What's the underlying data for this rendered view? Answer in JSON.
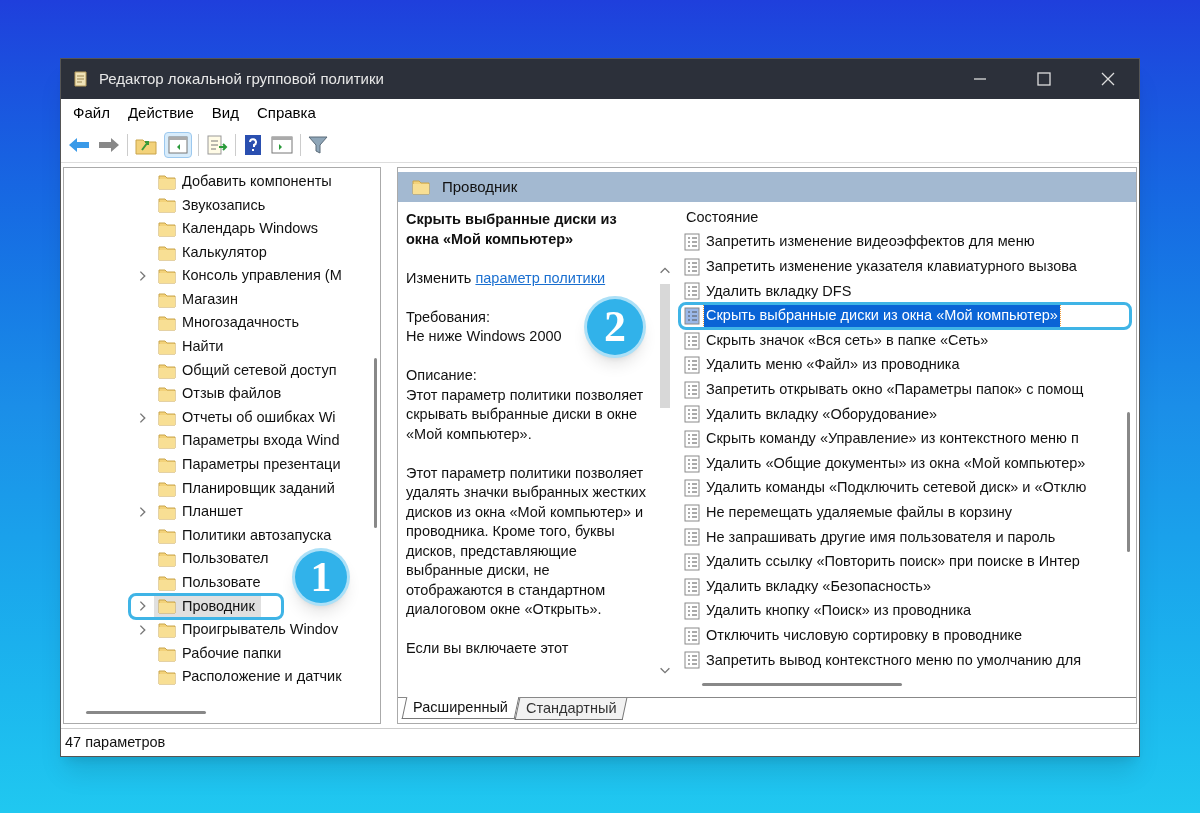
{
  "window": {
    "title": "Редактор локальной групповой политики"
  },
  "menu": [
    "Файл",
    "Действие",
    "Вид",
    "Справка"
  ],
  "tree": {
    "items": [
      {
        "label": "Добавить компоненты",
        "expandable": false,
        "selected": false
      },
      {
        "label": "Звукозапись",
        "expandable": false,
        "selected": false
      },
      {
        "label": "Календарь Windows",
        "expandable": false,
        "selected": false
      },
      {
        "label": "Калькулятор",
        "expandable": false,
        "selected": false
      },
      {
        "label": "Консоль управления (M",
        "expandable": true,
        "selected": false
      },
      {
        "label": "Магазин",
        "expandable": false,
        "selected": false
      },
      {
        "label": "Многозадачность",
        "expandable": false,
        "selected": false
      },
      {
        "label": "Найти",
        "expandable": false,
        "selected": false
      },
      {
        "label": "Общий сетевой доступ",
        "expandable": false,
        "selected": false
      },
      {
        "label": "Отзыв файлов",
        "expandable": false,
        "selected": false
      },
      {
        "label": "Отчеты об ошибках Wi",
        "expandable": true,
        "selected": false
      },
      {
        "label": "Параметры входа Wind",
        "expandable": false,
        "selected": false
      },
      {
        "label": "Параметры презентаци",
        "expandable": false,
        "selected": false
      },
      {
        "label": "Планировщик заданий",
        "expandable": false,
        "selected": false
      },
      {
        "label": "Планшет",
        "expandable": true,
        "selected": false
      },
      {
        "label": "Политики автозапуска",
        "expandable": false,
        "selected": false
      },
      {
        "label": "Пользовател",
        "expandable": false,
        "selected": false
      },
      {
        "label": "Пользовате",
        "expandable": false,
        "selected": false
      },
      {
        "label": "Проводник",
        "expandable": true,
        "selected": true
      },
      {
        "label": "Проигрыватель Windov",
        "expandable": true,
        "selected": false
      },
      {
        "label": "Рабочие папки",
        "expandable": false,
        "selected": false
      },
      {
        "label": "Расположение и датчик",
        "expandable": false,
        "selected": false
      }
    ]
  },
  "header": {
    "title": "Проводник"
  },
  "description": {
    "title": "Скрыть выбранные диски из окна «Мой компьютер»",
    "edit_prefix": "Изменить",
    "edit_link": "параметр политики",
    "paragraphs": [
      "Требования:\nНе ниже Windows 2000",
      "Описание:\nЭтот параметр политики позволяет скрывать выбранные диски в окне «Мой компьютер».",
      "Этот параметр политики позволяет удалять значки выбранных жестких дисков из окна «Мой компьютер» и проводника. Кроме того, буквы дисков, представляющие выбранные диски, не отображаются в стандартном диалоговом окне «Открыть».",
      "Если вы включаете этот"
    ]
  },
  "list": {
    "column": "Состояние",
    "rows": [
      {
        "label": "Запретить изменение видеоэффектов для меню",
        "selected": false
      },
      {
        "label": "Запретить изменение указателя клавиатурного вызова",
        "selected": false
      },
      {
        "label": "Удалить вкладку DFS",
        "selected": false
      },
      {
        "label": "Скрыть выбранные диски из окна «Мой компьютер»",
        "selected": true
      },
      {
        "label": "Скрыть значок «Вся сеть» в папке «Сеть»",
        "selected": false
      },
      {
        "label": "Удалить меню «Файл» из проводника",
        "selected": false
      },
      {
        "label": "Запретить открывать окно «Параметры папок» с помощ",
        "selected": false
      },
      {
        "label": "Удалить вкладку «Оборудование»",
        "selected": false
      },
      {
        "label": "Скрыть команду «Управление» из контекстного меню п",
        "selected": false
      },
      {
        "label": "Удалить «Общие документы» из окна «Мой компьютер»",
        "selected": false
      },
      {
        "label": "Удалить команды «Подключить сетевой диск» и «Отклю",
        "selected": false
      },
      {
        "label": "Не перемещать удаляемые файлы в корзину",
        "selected": false
      },
      {
        "label": "Не запрашивать другие имя пользователя и пароль",
        "selected": false
      },
      {
        "label": "Удалить ссылку «Повторить поиск» при поиске в Интер",
        "selected": false
      },
      {
        "label": "Удалить вкладку «Безопасность»",
        "selected": false
      },
      {
        "label": "Удалить кнопку «Поиск» из проводника",
        "selected": false
      },
      {
        "label": "Отключить числовую сортировку в проводнике",
        "selected": false
      },
      {
        "label": "Запретить вывод контекстного меню по умолчанию для",
        "selected": false
      }
    ]
  },
  "tabs": [
    {
      "label": "Расширенный",
      "selected": true
    },
    {
      "label": "Стандартный",
      "selected": false
    }
  ],
  "status_bar": "47 параметров",
  "callouts": [
    "1",
    "2"
  ]
}
